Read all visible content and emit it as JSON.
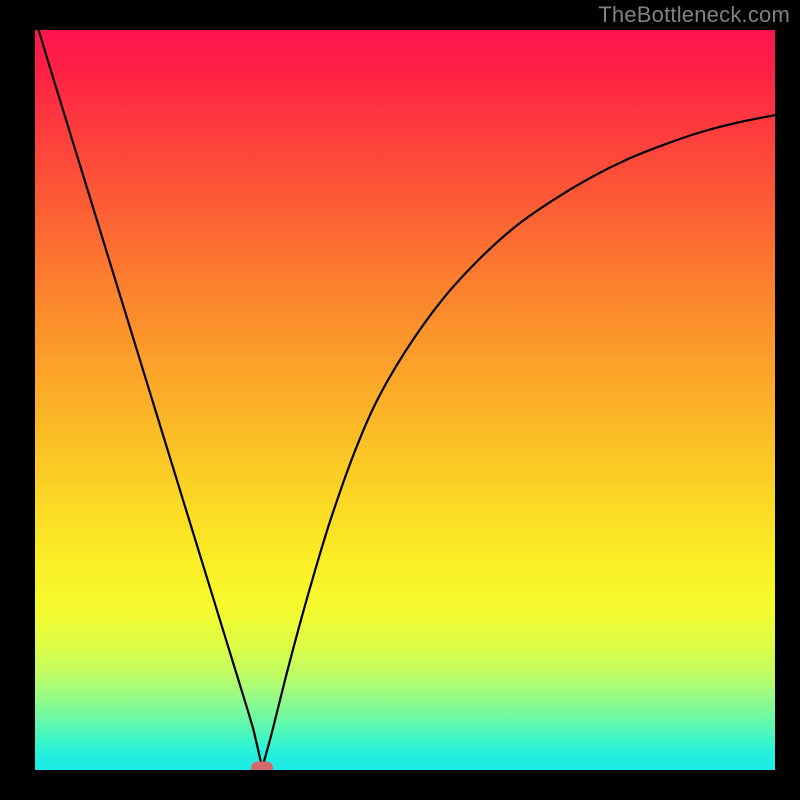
{
  "watermark": "TheBottleneck.com",
  "chart_data": {
    "type": "line",
    "title": "",
    "xlabel": "",
    "ylabel": "",
    "xlim": [
      0,
      1
    ],
    "ylim": [
      0,
      1
    ],
    "grid": false,
    "legend": false,
    "min_point": {
      "x": 0.307,
      "y": 0.003
    },
    "series": [
      {
        "name": "curve",
        "stroke": "#000000",
        "x": [
          0.005,
          0.02,
          0.04,
          0.06,
          0.08,
          0.1,
          0.12,
          0.14,
          0.16,
          0.18,
          0.2,
          0.22,
          0.24,
          0.26,
          0.28,
          0.295,
          0.307,
          0.32,
          0.34,
          0.36,
          0.38,
          0.4,
          0.43,
          0.46,
          0.5,
          0.55,
          0.6,
          0.65,
          0.7,
          0.75,
          0.8,
          0.85,
          0.9,
          0.95,
          1.0
        ],
        "y": [
          1.0,
          0.95,
          0.885,
          0.82,
          0.755,
          0.69,
          0.625,
          0.56,
          0.495,
          0.43,
          0.365,
          0.3,
          0.235,
          0.17,
          0.105,
          0.055,
          0.003,
          0.05,
          0.13,
          0.205,
          0.275,
          0.34,
          0.425,
          0.495,
          0.565,
          0.635,
          0.69,
          0.735,
          0.77,
          0.8,
          0.825,
          0.845,
          0.862,
          0.875,
          0.885
        ]
      }
    ],
    "marker": {
      "x": 0.307,
      "y": 0.003,
      "color": "#d46a6a"
    },
    "background_gradient": {
      "top": "#ff1450",
      "bottom": "#1debe7"
    }
  }
}
